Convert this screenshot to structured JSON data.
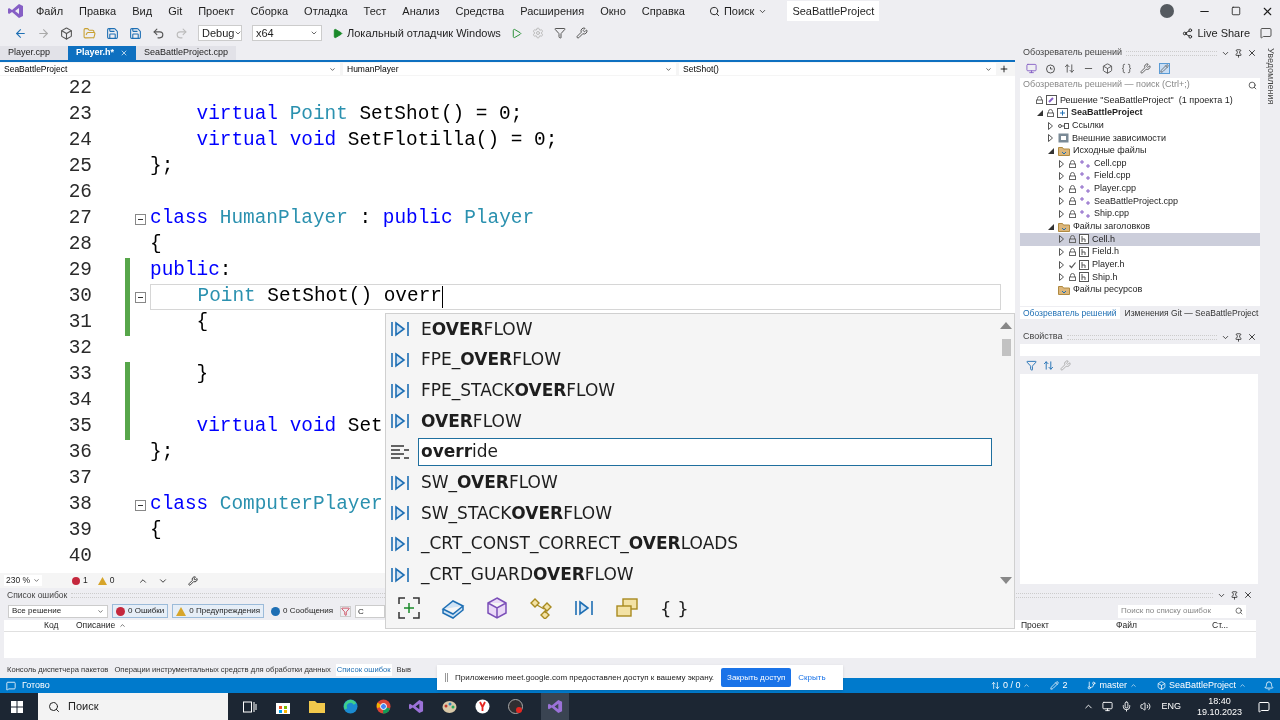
{
  "title_bar": {
    "menu": [
      "Файл",
      "Правка",
      "Вид",
      "Git",
      "Проект",
      "Сборка",
      "Отладка",
      "Тест",
      "Анализ",
      "Средства",
      "Расширения",
      "Окно",
      "Справка"
    ],
    "search": "Поиск",
    "project": "SeaBattleProject"
  },
  "toolbar": {
    "configuration": "Debug",
    "platform": "x64",
    "run": "Локальный отладчик Windows",
    "live_share": "Live Share"
  },
  "editor_tabs": [
    {
      "label": "Player.cpp",
      "selected": false
    },
    {
      "label": "Player.h*",
      "selected": true
    },
    {
      "label": "SeaBattleProject.cpp",
      "selected": false
    }
  ],
  "nav_bar": {
    "project": "SeaBattleProject",
    "scope": "HumanPlayer",
    "member": "SetShot()"
  },
  "code_lines": [
    {
      "number": "22",
      "current": false,
      "changed": false,
      "foldable": false
    },
    {
      "number": "23",
      "current": false,
      "changed": false,
      "foldable": false,
      "segments": [
        {
          "text": "    virtual ",
          "kind": "keyword"
        },
        {
          "text": "Point",
          "kind": "type"
        },
        {
          "text": " SetShot() = 0;",
          "kind": "plain"
        }
      ]
    },
    {
      "number": "24",
      "current": false,
      "changed": false,
      "foldable": false,
      "segments": [
        {
          "text": "    virtual void",
          "kind": "keyword"
        },
        {
          "text": " SetFlotilla() = 0;",
          "kind": "plain"
        }
      ]
    },
    {
      "number": "25",
      "current": false,
      "changed": false,
      "foldable": false,
      "segments": [
        {
          "text": "};",
          "kind": "plain"
        }
      ]
    },
    {
      "number": "26",
      "current": false,
      "changed": false,
      "foldable": false
    },
    {
      "number": "27",
      "current": false,
      "changed": false,
      "foldable": true,
      "segments": [
        {
          "text": "class ",
          "kind": "keyword"
        },
        {
          "text": "HumanPlayer",
          "kind": "type"
        },
        {
          "text": " : ",
          "kind": "plain"
        },
        {
          "text": "public ",
          "kind": "keyword"
        },
        {
          "text": "Player",
          "kind": "type"
        }
      ]
    },
    {
      "number": "28",
      "current": false,
      "changed": false,
      "foldable": false,
      "segments": [
        {
          "text": "{",
          "kind": "plain"
        }
      ]
    },
    {
      "number": "29",
      "current": false,
      "changed": true,
      "foldable": false,
      "segments": [
        {
          "text": "public",
          "kind": "keyword"
        },
        {
          "text": ":",
          "kind": "plain"
        }
      ]
    },
    {
      "number": "30",
      "current": true,
      "changed": true,
      "foldable": true,
      "segments": [
        {
          "text": "    Point",
          "kind": "type"
        },
        {
          "text": " SetShot() overr",
          "kind": "plain"
        }
      ]
    },
    {
      "number": "31",
      "current": false,
      "changed": true,
      "foldable": false,
      "segments": [
        {
          "text": "    {",
          "kind": "plain"
        }
      ]
    },
    {
      "number": "32",
      "current": false,
      "changed": false,
      "foldable": false
    },
    {
      "number": "33",
      "current": false,
      "changed": true,
      "foldable": false,
      "segments": [
        {
          "text": "    }",
          "kind": "plain"
        }
      ]
    },
    {
      "number": "34",
      "current": false,
      "changed": true,
      "foldable": false
    },
    {
      "number": "35",
      "current": false,
      "changed": true,
      "foldable": false,
      "segments": [
        {
          "text": "    virtual void",
          "kind": "keyword"
        },
        {
          "text": " Set",
          "kind": "plain"
        }
      ]
    },
    {
      "number": "36",
      "current": false,
      "changed": false,
      "foldable": false,
      "segments": [
        {
          "text": "};",
          "kind": "plain"
        }
      ]
    },
    {
      "number": "37",
      "current": false,
      "changed": false,
      "foldable": false
    },
    {
      "number": "38",
      "current": false,
      "changed": false,
      "foldable": true,
      "segments": [
        {
          "text": "class ",
          "kind": "keyword"
        },
        {
          "text": "ComputerPlayer",
          "kind": "type"
        }
      ]
    },
    {
      "number": "39",
      "current": false,
      "changed": false,
      "foldable": false,
      "segments": [
        {
          "text": "{",
          "kind": "plain"
        }
      ]
    },
    {
      "number": "40",
      "current": false,
      "changed": false,
      "foldable": false
    }
  ],
  "completion": {
    "items": [
      {
        "text": "E**OVER**FLOW",
        "kind": "macro",
        "selected": false
      },
      {
        "text": "FPE_**OVER**FLOW",
        "kind": "macro",
        "selected": false
      },
      {
        "text": "FPE_STACK**OVER**FLOW",
        "kind": "macro",
        "selected": false
      },
      {
        "text": "**OVER**FLOW",
        "kind": "macro",
        "selected": false
      },
      {
        "text": "**overr**ide",
        "kind": "keyword",
        "selected": true
      },
      {
        "text": "SW_**OVER**FLOW",
        "kind": "macro",
        "selected": false
      },
      {
        "text": "SW_STACK**OVER**FLOW",
        "kind": "macro",
        "selected": false
      },
      {
        "text": "_CRT_CONST_CORRECT_**OVER**LOADS",
        "kind": "macro",
        "selected": false
      },
      {
        "text": "_CRT_GUARD**OVER**FLOW",
        "kind": "macro",
        "selected": false
      }
    ],
    "namespace_filter": "{ }"
  },
  "zoom_bar": {
    "zoom": "230 %",
    "errors": "1",
    "warnings": "0"
  },
  "solution_explorer": {
    "title": "Обозреватель решений",
    "search_placeholder": "Обозреватель решений — поиск (Ctrl+;)",
    "tree": [
      {
        "label": "Решение \"SeaBattleProject\"  (1 проекта 1)",
        "kind": "solution",
        "locked": true,
        "edited": false,
        "expandable": false,
        "selected": false,
        "children": [
          {
            "label": "SeaBattleProject",
            "kind": "project",
            "locked": true,
            "edited": false,
            "expandable": true,
            "expanded": true,
            "selected": false,
            "children": [
              {
                "label": "Ссылки",
                "kind": "references",
                "locked": false,
                "edited": false,
                "expandable": true,
                "expanded": false,
                "selected": false
              },
              {
                "label": "Внешние зависимости",
                "kind": "dependencies",
                "locked": false,
                "edited": false,
                "expandable": true,
                "expanded": false,
                "selected": false
              },
              {
                "label": "Исходные файлы",
                "kind": "folder",
                "locked": false,
                "edited": false,
                "expandable": true,
                "expanded": true,
                "selected": false,
                "children": [
                  {
                    "label": "Cell.cpp",
                    "kind": "cpp",
                    "locked": true,
                    "edited": false,
                    "expandable": true,
                    "expanded": false,
                    "selected": false
                  },
                  {
                    "label": "Field.cpp",
                    "kind": "cpp",
                    "locked": true,
                    "edited": false,
                    "expandable": true,
                    "expanded": false,
                    "selected": false
                  },
                  {
                    "label": "Player.cpp",
                    "kind": "cpp",
                    "locked": true,
                    "edited": false,
                    "expandable": true,
                    "expanded": false,
                    "selected": false
                  },
                  {
                    "label": "SeaBattleProject.cpp",
                    "kind": "cpp",
                    "locked": true,
                    "edited": false,
                    "expandable": true,
                    "expanded": false,
                    "selected": false
                  },
                  {
                    "label": "Ship.cpp",
                    "kind": "cpp",
                    "locked": true,
                    "edited": false,
                    "expandable": true,
                    "expanded": false,
                    "selected": false
                  }
                ]
              },
              {
                "label": "Файлы заголовков",
                "kind": "folder",
                "locked": false,
                "edited": false,
                "expandable": true,
                "expanded": true,
                "selected": false,
                "children": [
                  {
                    "label": "Cell.h",
                    "kind": "header",
                    "locked": true,
                    "edited": false,
                    "expandable": true,
                    "expanded": false,
                    "selected": true
                  },
                  {
                    "label": "Field.h",
                    "kind": "header",
                    "locked": true,
                    "edited": false,
                    "expandable": true,
                    "expanded": false,
                    "selected": false
                  },
                  {
                    "label": "Player.h",
                    "kind": "header",
                    "locked": false,
                    "edited": true,
                    "expandable": true,
                    "expanded": false,
                    "selected": false
                  },
                  {
                    "label": "Ship.h",
                    "kind": "header",
                    "locked": true,
                    "edited": false,
                    "expandable": true,
                    "expanded": false,
                    "selected": false
                  }
                ]
              },
              {
                "label": "Файлы ресурсов",
                "kind": "folder",
                "locked": false,
                "edited": false,
                "expandable": false,
                "selected": false
              }
            ]
          }
        ]
      }
    ],
    "tabs": [
      {
        "label": "Обозреватель решений",
        "selected": true
      },
      {
        "label": "Изменения Git — SeaBattleProject",
        "selected": false
      }
    ]
  },
  "properties": {
    "title": "Свойства"
  },
  "notifications_tab": "Уведомления",
  "error_list": {
    "title": "Список ошибок",
    "scope": "Все решение",
    "filters": [
      {
        "label": "0 Ошибки",
        "kind": "error",
        "selected": true
      },
      {
        "label": "0 Предупреждения",
        "kind": "warning",
        "selected": true
      },
      {
        "label": "0 Сообщения",
        "kind": "info",
        "selected": false
      }
    ],
    "source": "С",
    "search_placeholder": "Поиск по списку ошибок",
    "columns": [
      "Код",
      "Описание",
      "Проект",
      "Файл",
      "Ст..."
    ]
  },
  "bottom_tabs": [
    {
      "label": "Консоль диспетчера пакетов",
      "selected": false
    },
    {
      "label": "Операции инструментальных средств для обработки данных",
      "selected": false
    },
    {
      "label": "Список ошибок",
      "selected": true
    },
    {
      "label": "Выв",
      "selected": false
    }
  ],
  "status_bar": {
    "state": "Готово",
    "sync": "0 / 0",
    "edits": "2",
    "branch": "master",
    "repo": "SeaBattleProject"
  },
  "share_notice": {
    "text": "Приложению meet.google.com предоставлен доступ к вашему экрану.",
    "stop": "Закрыть доступ",
    "hide": "Скрыть"
  },
  "taskbar": {
    "search": "Поиск",
    "language": "ENG",
    "time": "18:40",
    "date": "19.10.2023"
  }
}
